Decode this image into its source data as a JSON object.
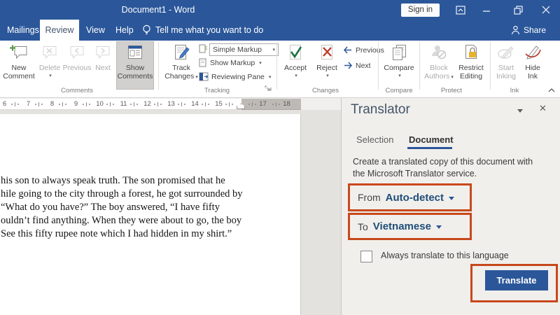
{
  "title_bar": {
    "title": "Document1 - Word",
    "sign_in": "Sign in"
  },
  "ribbon_tabs": {
    "tabs": [
      {
        "label": "Mailings"
      },
      {
        "label": "Review"
      },
      {
        "label": "View"
      },
      {
        "label": "Help"
      }
    ],
    "tell_me": "Tell me what you want to do",
    "share": "Share"
  },
  "ribbon": {
    "comments": {
      "new_comment_1": "New",
      "new_comment_2": "Comment",
      "delete": "Delete",
      "previous": "Previous",
      "next": "Next",
      "show_1": "Show",
      "show_2": "Comments",
      "label": "Comments"
    },
    "tracking": {
      "track_1": "Track",
      "track_2": "Changes",
      "simple_markup": "Simple Markup",
      "show_markup": "Show Markup",
      "reviewing_pane": "Reviewing Pane",
      "label": "Tracking"
    },
    "changes": {
      "accept": "Accept",
      "reject": "Reject",
      "previous": "Previous",
      "next": "Next",
      "label": "Changes"
    },
    "compare": {
      "compare": "Compare",
      "label": "Compare"
    },
    "protect": {
      "block_1": "Block",
      "block_2": "Authors",
      "restrict_1": "Restrict",
      "restrict_2": "Editing",
      "label": "Protect"
    },
    "ink": {
      "start_1": "Start",
      "start_2": "Inking",
      "hide_1": "Hide",
      "hide_2": "Ink",
      "label": "Ink"
    }
  },
  "ruler": {
    "numbers": [
      "6",
      "7",
      "8",
      "9",
      "10",
      "11",
      "12",
      "13",
      "14",
      "15"
    ],
    "numbers_gray": [
      "17",
      "18"
    ]
  },
  "document": {
    "lines": [
      "his son to always speak truth. The son promised that he",
      "hile going to the city through a forest, he got surrounded by",
      "“What do you have?” The boy answered, “I have fifty",
      "ouldn’t find anything. When they were about to go, the boy",
      "See this fifty rupee note which I had hidden in my shirt.”"
    ]
  },
  "translator": {
    "title": "Translator",
    "tab_selection": "Selection",
    "tab_document": "Document",
    "description_line1": "Create a translated copy of this document with",
    "description_line2": "the Microsoft Translator service.",
    "from_label": "From",
    "from_value": "Auto-detect",
    "to_label": "To",
    "to_value": "Vietnamese",
    "always_checkbox_label": "Always translate to this language",
    "translate_button": "Translate"
  },
  "colors": {
    "titlebar_blue": "#2b579a",
    "accent_blue": "#2b579a",
    "highlight_orange": "#c8481c",
    "language_navy": "#1f4e79"
  }
}
